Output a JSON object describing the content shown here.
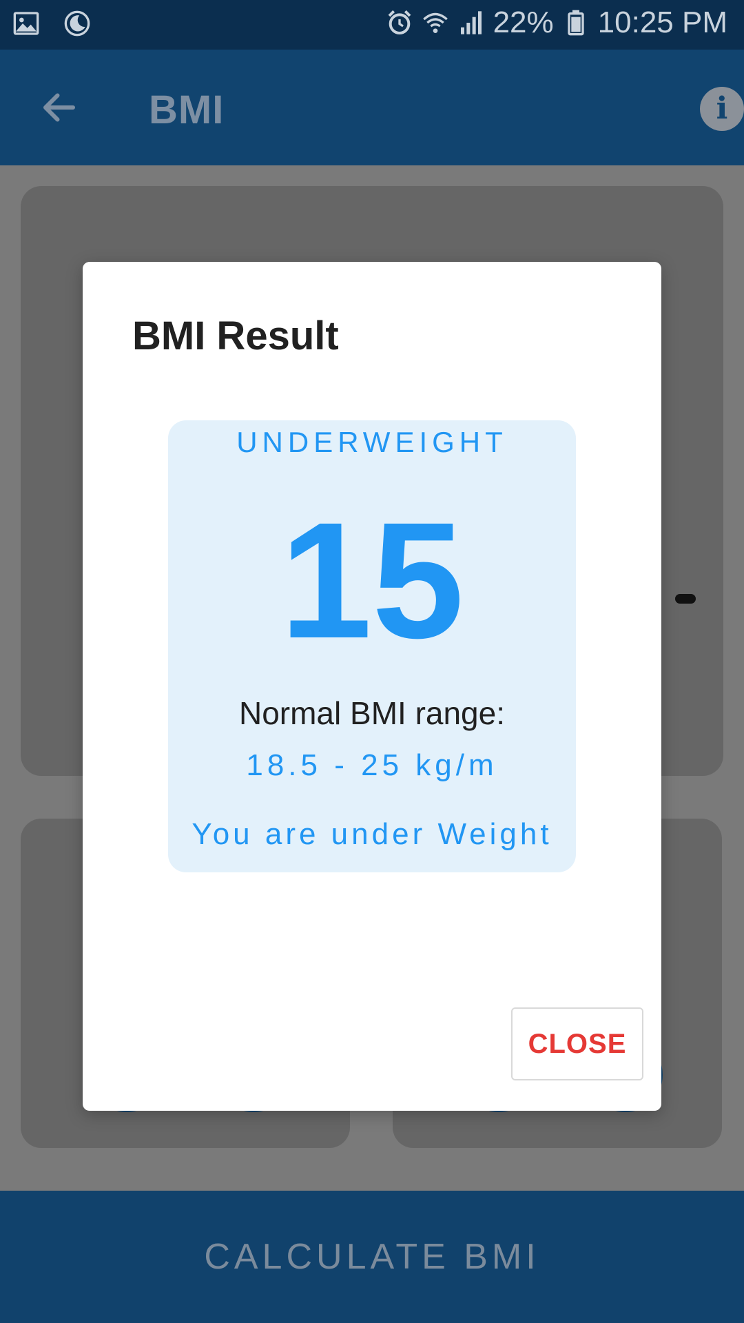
{
  "status_bar": {
    "battery_percent": "22%",
    "time": "10:25 PM",
    "icons": [
      "gallery-icon",
      "do-not-disturb-icon",
      "alarm-icon",
      "wifi-icon",
      "signal-icon",
      "battery-icon"
    ]
  },
  "app_bar": {
    "title": "BMI",
    "back_icon": "arrow-back-icon",
    "info_icon": "info-icon",
    "info_glyph": "i"
  },
  "bottom_bar": {
    "label": "CALCULATE BMI"
  },
  "dialog": {
    "title": "BMI Result",
    "result": {
      "category": "UNDERWEIGHT",
      "bmi_value": "15",
      "range_label": "Normal BMI range:",
      "range_value": "18.5 - 25 kg/m",
      "message": "You are under Weight"
    },
    "close_label": "CLOSE"
  },
  "colors": {
    "accent_blue": "#2196f3",
    "result_bg": "#e3f1fb",
    "close_red": "#e53935",
    "app_bar": "#11446f"
  }
}
